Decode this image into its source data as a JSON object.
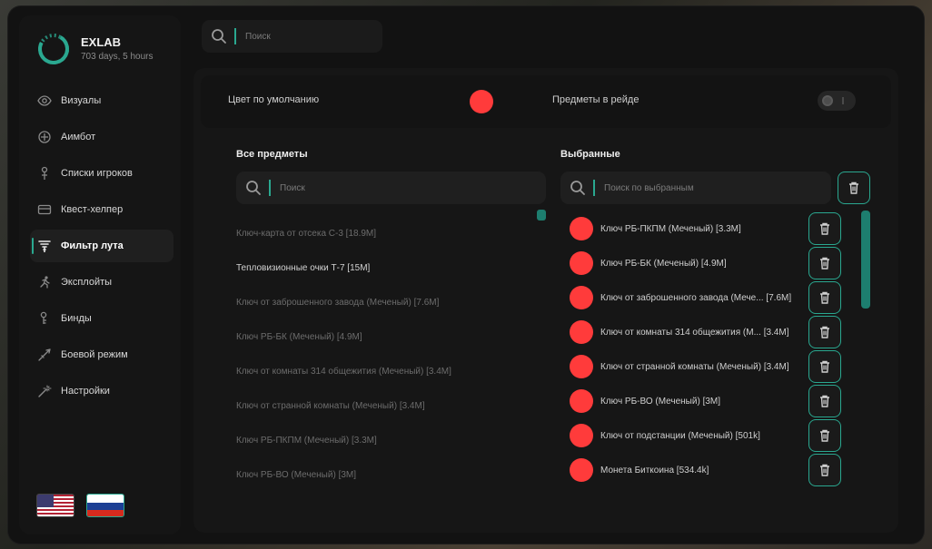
{
  "brand": {
    "name": "EXLAB",
    "subtitle": "703 days, 5 hours"
  },
  "top_search": {
    "placeholder": "Поиск"
  },
  "nav": [
    {
      "label": "Визуалы",
      "icon": "eye-icon"
    },
    {
      "label": "Аимбот",
      "icon": "crosshair-icon"
    },
    {
      "label": "Списки игроков",
      "icon": "person-icon"
    },
    {
      "label": "Квест-хелпер",
      "icon": "card-icon"
    },
    {
      "label": "Фильтр лута",
      "icon": "filter-icon",
      "active": true
    },
    {
      "label": "Эксплойты",
      "icon": "running-icon"
    },
    {
      "label": "Бинды",
      "icon": "key-icon"
    },
    {
      "label": "Боевой режим",
      "icon": "sword-icon"
    },
    {
      "label": "Настройки",
      "icon": "wand-icon"
    }
  ],
  "settings": {
    "default_color_label": "Цвет по умолчанию",
    "default_color": "#ff3b3b",
    "raid_items_label": "Предметы в рейде",
    "raid_items_enabled": false
  },
  "all_items": {
    "title": "Все предметы",
    "search_placeholder": "Поиск",
    "items": [
      "Ключ-карта от отсека С-3  [18.9M]",
      "Тепловизионные очки Т-7  [15M]",
      "Ключ от заброшенного завода (Меченый)  [7.6M]",
      "Ключ РБ-БК (Меченый)  [4.9M]",
      "Ключ от комнаты 314 общежития (Меченый)  [3.4M]",
      "Ключ от странной комнаты (Меченый)  [3.4M]",
      "Ключ РБ-ПКПМ (Меченый)  [3.3M]",
      "Ключ РБ-ВО (Меченый)  [3M]"
    ]
  },
  "selected": {
    "title": "Выбранные",
    "search_placeholder": "Поиск по выбранным",
    "items": [
      "Ключ РБ-ПКПМ (Меченый)  [3.3M]",
      "Ключ РБ-БК (Меченый)  [4.9M]",
      "Ключ от заброшенного завода (Мече...  [7.6M]",
      "Ключ от комнаты 314 общежития (М...  [3.4M]",
      "Ключ от странной комнаты (Меченый)  [3.4M]",
      "Ключ РБ-ВО (Меченый)  [3M]",
      "Ключ от подстанции (Меченый)  [501k]",
      "Монета Биткоина  [534.4k]"
    ],
    "item_color": "#ff3b3b"
  },
  "colors": {
    "accent": "#2aa890",
    "danger": "#ff3b3b"
  }
}
